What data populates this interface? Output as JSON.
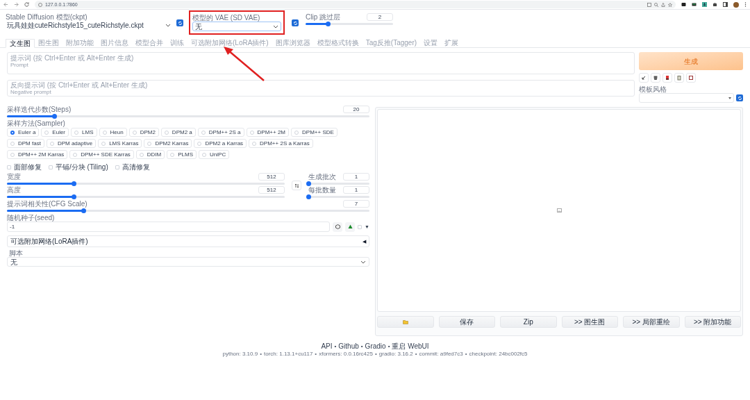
{
  "browser": {
    "url": "127.0.0.1:7860"
  },
  "checkpoint": {
    "label": "Stable Diffusion 模型(ckpt)",
    "value": "玩具娃娃cuteRichstyle15_cuteRichstyle.ckpt"
  },
  "vae": {
    "label": "模型的 VAE (SD VAE)",
    "value": "无"
  },
  "clip": {
    "label": "Clip 跳过层",
    "value": "2",
    "level": 0.25
  },
  "tabs": [
    {
      "label": "文生图",
      "selected": true
    },
    {
      "label": "图生图",
      "selected": false
    },
    {
      "label": "附加功能",
      "selected": false
    },
    {
      "label": "图片信息",
      "selected": false
    },
    {
      "label": "模型合并",
      "selected": false
    },
    {
      "label": "训练",
      "selected": false
    },
    {
      "label": "可选附加网络(LoRA插件)",
      "selected": false
    },
    {
      "label": "图库浏览器",
      "selected": false
    },
    {
      "label": "模型格式转换",
      "selected": false
    },
    {
      "label": "Tag反推(Tagger)",
      "selected": false
    },
    {
      "label": "设置",
      "selected": false
    },
    {
      "label": "扩展",
      "selected": false
    }
  ],
  "prompt": {
    "label": "提示词 (按 Ctrl+Enter 或 Alt+Enter 生成)",
    "placeholder": "Prompt"
  },
  "negative_prompt": {
    "label": "反向提示词 (按 Ctrl+Enter 或 Alt+Enter 生成)",
    "placeholder": "Negative prompt"
  },
  "generate_button": "生成",
  "styles": {
    "label": "模板风格"
  },
  "steps": {
    "label": "采样迭代步数(Steps)",
    "value": "20",
    "level": 0.13
  },
  "sampler": {
    "label": "采样方法(Sampler)",
    "options": [
      {
        "label": "Euler a",
        "selected": true
      },
      {
        "label": "Euler",
        "selected": false
      },
      {
        "label": "LMS",
        "selected": false
      },
      {
        "label": "Heun",
        "selected": false
      },
      {
        "label": "DPM2",
        "selected": false
      },
      {
        "label": "DPM2 a",
        "selected": false
      },
      {
        "label": "DPM++ 2S a",
        "selected": false
      },
      {
        "label": "DPM++ 2M",
        "selected": false
      },
      {
        "label": "DPM++ SDE",
        "selected": false
      },
      {
        "label": "DPM fast",
        "selected": false
      },
      {
        "label": "DPM adaptive",
        "selected": false
      },
      {
        "label": "LMS Karras",
        "selected": false
      },
      {
        "label": "DPM2 Karras",
        "selected": false
      },
      {
        "label": "DPM2 a Karras",
        "selected": false
      },
      {
        "label": "DPM++ 2S a Karras",
        "selected": false
      },
      {
        "label": "DPM++ 2M Karras",
        "selected": false
      },
      {
        "label": "DPM++ SDE Karras",
        "selected": false
      },
      {
        "label": "DDIM",
        "selected": false
      },
      {
        "label": "PLMS",
        "selected": false
      },
      {
        "label": "UniPC",
        "selected": false
      }
    ]
  },
  "options": [
    {
      "label": "面部修复",
      "checked": false
    },
    {
      "label": "平铺/分块 (Tiling)",
      "checked": false
    },
    {
      "label": "高清修复",
      "checked": false
    }
  ],
  "width": {
    "label": "宽度",
    "value": "512",
    "level": 0.24
  },
  "height": {
    "label": "高度",
    "value": "512",
    "level": 0.24
  },
  "batch_count": {
    "label": "生成批次",
    "value": "1",
    "level": 0
  },
  "batch_size": {
    "label": "每批数量",
    "value": "1",
    "level": 0
  },
  "cfg": {
    "label": "提示词相关性(CFG Scale)",
    "value": "7",
    "level": 0.21
  },
  "seed": {
    "label": "随机种子(seed)",
    "value": "-1",
    "extra_checked": false,
    "toggle": "▼"
  },
  "lora": {
    "title": "可选附加网络(LoRA插件)",
    "toggle": "◀"
  },
  "script": {
    "label": "脚本",
    "value": "无"
  },
  "output_buttons": [
    {
      "kind": "folder"
    },
    {
      "kind": "text",
      "label": "保存"
    },
    {
      "kind": "text",
      "label": "Zip"
    },
    {
      "kind": "text",
      "label": ">> 图生图"
    },
    {
      "kind": "text",
      "label": ">> 局部重绘"
    },
    {
      "kind": "text",
      "label": ">> 附加功能"
    }
  ],
  "footer": {
    "separator": "•",
    "links": [
      "API",
      "Github",
      "Gradio",
      "重启 WebUI"
    ],
    "versions": [
      "python: 3.10.9",
      "torch: 1.13.1+cu117",
      "xformers: 0.0.16rc425",
      "gradio: 3.16.2",
      "commit: a9fed7c3",
      "checkpoint: 24bc002fc5"
    ]
  }
}
